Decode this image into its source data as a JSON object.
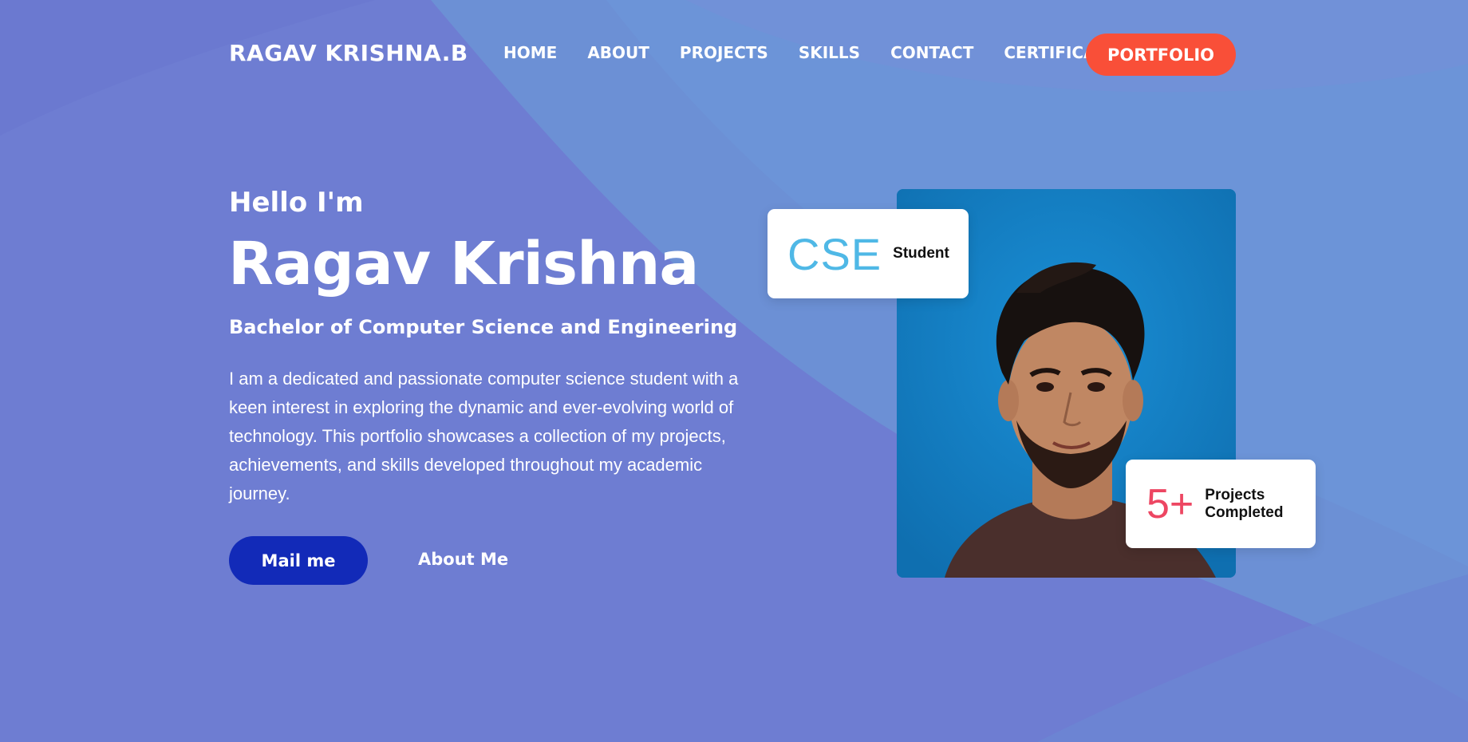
{
  "header": {
    "brand": "RAGAV KRISHNA.B",
    "nav": [
      "HOME",
      "ABOUT",
      "PROJECTS",
      "SKILLS",
      "CONTACT",
      "CERTIFICATIONS"
    ],
    "cta": "PORTFOLIO"
  },
  "hero": {
    "greeting": "Hello I'm",
    "name": "Ragav Krishna",
    "degree": "Bachelor of Computer Science and Engineering",
    "bio": "I am a dedicated and passionate computer science student with a keen interest in exploring the dynamic and ever-evolving world of technology. This portfolio showcases a collection of my projects, achievements, and skills developed throughout my academic journey.",
    "primary_button": "Mail me",
    "secondary_link": "About Me"
  },
  "cards": {
    "cse": {
      "big": "CSE",
      "label": "Student"
    },
    "projects": {
      "big": "5+",
      "label": "Projects Completed"
    }
  },
  "colors": {
    "background": "#6e7dd2",
    "accent_orange": "#f94f38",
    "button_blue": "#122ab8",
    "cse_blue": "#4fb8e6",
    "projects_red": "#ed4662"
  }
}
